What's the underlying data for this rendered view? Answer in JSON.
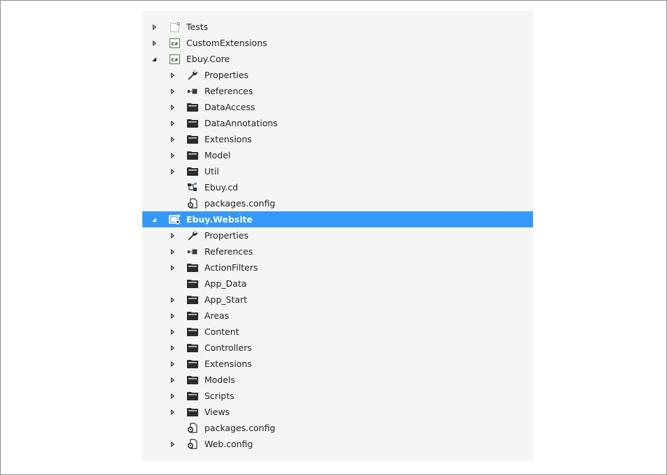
{
  "colors": {
    "selection": "#3399ff",
    "panel": "#f5f5f5",
    "text": "#1e1e1e",
    "csproj_border": "#3c8c3c"
  },
  "tree": [
    {
      "label": "Tests",
      "level": 0,
      "arrow": "closed",
      "icon": "test-project-icon"
    },
    {
      "label": "CustomExtensions",
      "level": 0,
      "arrow": "closed",
      "icon": "csharp-project-icon"
    },
    {
      "label": "Ebuy.Core",
      "level": 0,
      "arrow": "open",
      "icon": "csharp-project-icon"
    },
    {
      "label": "Properties",
      "level": 1,
      "arrow": "closed",
      "icon": "wrench-icon"
    },
    {
      "label": "References",
      "level": 1,
      "arrow": "closed",
      "icon": "references-icon"
    },
    {
      "label": "DataAccess",
      "level": 1,
      "arrow": "closed",
      "icon": "folder-icon"
    },
    {
      "label": "DataAnnotations",
      "level": 1,
      "arrow": "closed",
      "icon": "folder-icon"
    },
    {
      "label": "Extensions",
      "level": 1,
      "arrow": "closed",
      "icon": "folder-icon"
    },
    {
      "label": "Model",
      "level": 1,
      "arrow": "closed",
      "icon": "folder-icon"
    },
    {
      "label": "Util",
      "level": 1,
      "arrow": "closed",
      "icon": "folder-icon"
    },
    {
      "label": "Ebuy.cd",
      "level": 1,
      "arrow": "none",
      "icon": "class-diagram-icon"
    },
    {
      "label": "packages.config",
      "level": 1,
      "arrow": "none",
      "icon": "config-file-icon"
    },
    {
      "label": "Ebuy.Website",
      "level": 0,
      "arrow": "open",
      "icon": "web-project-icon",
      "selected": true
    },
    {
      "label": "Properties",
      "level": 1,
      "arrow": "closed",
      "icon": "wrench-icon"
    },
    {
      "label": "References",
      "level": 1,
      "arrow": "closed",
      "icon": "references-icon"
    },
    {
      "label": "ActionFilters",
      "level": 1,
      "arrow": "closed",
      "icon": "folder-icon"
    },
    {
      "label": "App_Data",
      "level": 1,
      "arrow": "none",
      "icon": "folder-icon"
    },
    {
      "label": "App_Start",
      "level": 1,
      "arrow": "closed",
      "icon": "folder-icon"
    },
    {
      "label": "Areas",
      "level": 1,
      "arrow": "closed",
      "icon": "folder-icon"
    },
    {
      "label": "Content",
      "level": 1,
      "arrow": "closed",
      "icon": "folder-icon"
    },
    {
      "label": "Controllers",
      "level": 1,
      "arrow": "closed",
      "icon": "folder-icon"
    },
    {
      "label": "Extensions",
      "level": 1,
      "arrow": "closed",
      "icon": "folder-icon"
    },
    {
      "label": "Models",
      "level": 1,
      "arrow": "closed",
      "icon": "folder-icon"
    },
    {
      "label": "Scripts",
      "level": 1,
      "arrow": "closed",
      "icon": "folder-icon"
    },
    {
      "label": "Views",
      "level": 1,
      "arrow": "closed",
      "icon": "folder-icon"
    },
    {
      "label": "packages.config",
      "level": 1,
      "arrow": "none",
      "icon": "config-file-icon"
    },
    {
      "label": "Web.config",
      "level": 1,
      "arrow": "closed",
      "icon": "config-file-icon"
    }
  ]
}
